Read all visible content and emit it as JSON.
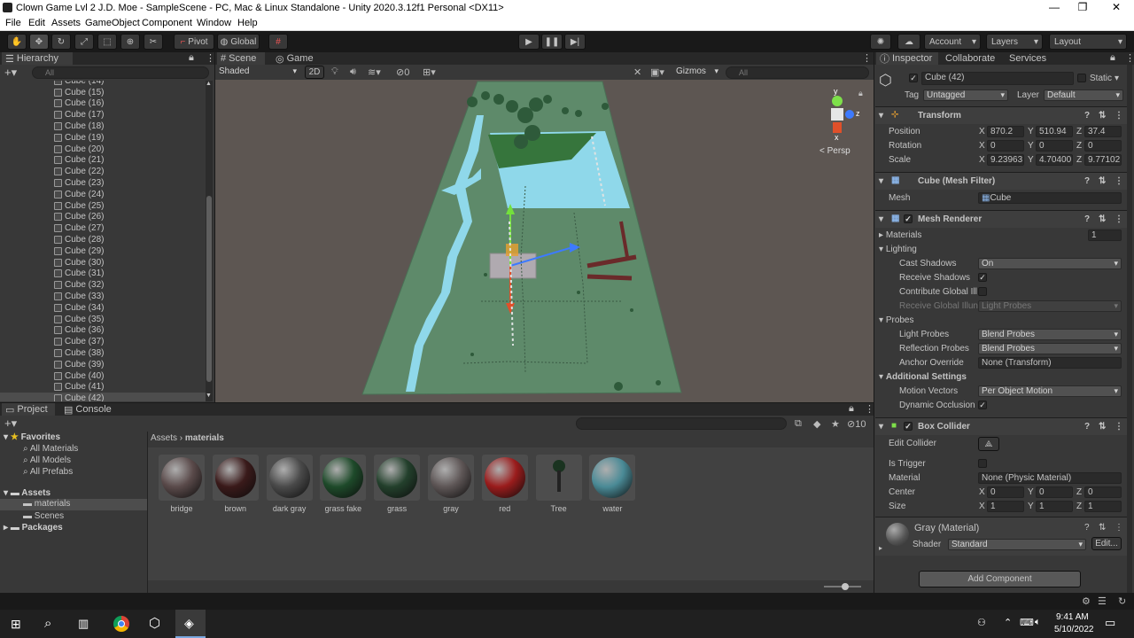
{
  "window": {
    "title": "Clown Game Lvl 2 J.D. Moe - SampleScene - PC, Mac & Linux Standalone - Unity 2020.3.12f1 Personal <DX11>"
  },
  "menu": [
    "File",
    "Edit",
    "Assets",
    "GameObject",
    "Component",
    "Window",
    "Help"
  ],
  "toolbar": {
    "pivot": "Pivot",
    "global": "Global",
    "account": "Account",
    "layers": "Layers",
    "layout": "Layout"
  },
  "hierarchy": {
    "tab": "Hierarchy",
    "search_placeholder": "All",
    "items": [
      "Cube (14)",
      "Cube (15)",
      "Cube (16)",
      "Cube (17)",
      "Cube (18)",
      "Cube (19)",
      "Cube (20)",
      "Cube (21)",
      "Cube (22)",
      "Cube (23)",
      "Cube (24)",
      "Cube (25)",
      "Cube (26)",
      "Cube (27)",
      "Cube (28)",
      "Cube (29)",
      "Cube (30)",
      "Cube (31)",
      "Cube (32)",
      "Cube (33)",
      "Cube (34)",
      "Cube (35)",
      "Cube (36)",
      "Cube (37)",
      "Cube (38)",
      "Cube (39)",
      "Cube (40)",
      "Cube (41)",
      "Cube (42)"
    ],
    "selected": "Cube (42)"
  },
  "scene": {
    "tabs": [
      "Scene",
      "Game"
    ],
    "shading": "Shaded",
    "mode2d": "2D",
    "hidden_count": "0",
    "gizmos": "Gizmos",
    "search_placeholder": "All",
    "persp": "< Persp",
    "axis_labels": {
      "y": "y",
      "z": "z",
      "x": "x"
    }
  },
  "project": {
    "tabs": [
      "Project",
      "Console"
    ],
    "favorites": {
      "label": "Favorites",
      "items": [
        "All Materials",
        "All Models",
        "All Prefabs"
      ]
    },
    "assets": {
      "label": "Assets",
      "items": [
        "materials",
        "Scenes"
      ]
    },
    "packages": "Packages",
    "breadcrumb": [
      "Assets",
      "materials"
    ],
    "count": "10",
    "materials": [
      {
        "name": "bridge",
        "color": "#5a4a4a"
      },
      {
        "name": "brown",
        "color": "#3a1a1a"
      },
      {
        "name": "dark gray",
        "color": "#4a4a4a"
      },
      {
        "name": "grass fake",
        "color": "#1e4a2a"
      },
      {
        "name": "grass",
        "color": "#23402c"
      },
      {
        "name": "gray",
        "color": "#5e5656"
      },
      {
        "name": "red",
        "color": "#9a1c1c"
      },
      {
        "name": "Tree",
        "color": "#1a3320"
      },
      {
        "name": "water",
        "color": "#4a8a96"
      }
    ]
  },
  "inspector": {
    "tabs": [
      "Inspector",
      "Collaborate",
      "Services"
    ],
    "object": {
      "name": "Cube (42)",
      "static": "Static",
      "tag_label": "Tag",
      "tag": "Untagged",
      "layer_label": "Layer",
      "layer": "Default"
    },
    "transform": {
      "title": "Transform",
      "position": {
        "label": "Position",
        "x": "870.2",
        "y": "510.94",
        "z": "37.4"
      },
      "rotation": {
        "label": "Rotation",
        "x": "0",
        "y": "0",
        "z": "0"
      },
      "scale": {
        "label": "Scale",
        "x": "9.23963",
        "y": "4.70400",
        "z": "9.77102"
      }
    },
    "mesh_filter": {
      "title": "Cube (Mesh Filter)",
      "mesh_label": "Mesh",
      "mesh": "Cube"
    },
    "mesh_renderer": {
      "title": "Mesh Renderer",
      "materials_label": "Materials",
      "materials_count": "1",
      "lighting": "Lighting",
      "cast_shadows_label": "Cast Shadows",
      "cast_shadows": "On",
      "receive_shadows": "Receive Shadows",
      "contribute_gi": "Contribute Global Ill",
      "receive_gi_label": "Receive Global Illun",
      "receive_gi": "Light Probes",
      "probes": "Probes",
      "light_probes_label": "Light Probes",
      "light_probes": "Blend Probes",
      "reflection_probes_label": "Reflection Probes",
      "reflection_probes": "Blend Probes",
      "anchor_override_label": "Anchor Override",
      "anchor_override": "None (Transform)",
      "additional": "Additional Settings",
      "motion_vectors_label": "Motion Vectors",
      "motion_vectors": "Per Object Motion",
      "dynamic_occlusion": "Dynamic Occlusion"
    },
    "box_collider": {
      "title": "Box Collider",
      "edit_collider": "Edit Collider",
      "is_trigger": "Is Trigger",
      "material_label": "Material",
      "material": "None (Physic Material)",
      "center": {
        "label": "Center",
        "x": "0",
        "y": "0",
        "z": "0"
      },
      "size": {
        "label": "Size",
        "x": "1",
        "y": "1",
        "z": "1"
      }
    },
    "material": {
      "name": "Gray (Material)",
      "shader_label": "Shader",
      "shader": "Standard",
      "edit": "Edit..."
    },
    "add_component": "Add Component"
  },
  "taskbar": {
    "time": "9:41 AM",
    "date": "5/10/2022"
  }
}
